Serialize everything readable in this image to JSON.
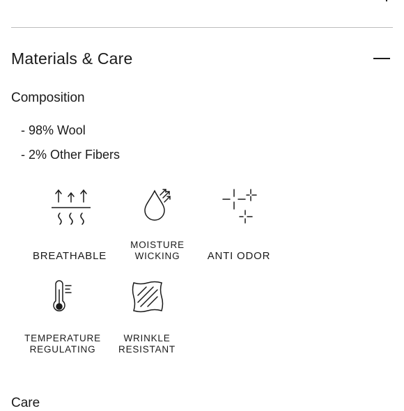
{
  "section": {
    "title": "Materials & Care"
  },
  "composition": {
    "heading": "Composition",
    "fibers": [
      "- 98% Wool",
      "- 2% Other Fibers"
    ]
  },
  "features": {
    "breathable": "BREATHABLE",
    "moisture_line1": "MOISTURE",
    "moisture_line2": "WICKING",
    "anti_odor": "ANTI ODOR",
    "temperature_line1": "TEMPERATURE",
    "temperature_line2": "REGULATING",
    "wrinkle_line1": "WRINKLE",
    "wrinkle_line2": "RESISTANT"
  },
  "care": {
    "heading": "Care"
  },
  "icons": {
    "breathable": "breathable-icon",
    "moisture": "water-drop-icon",
    "anti_odor": "sparkle-icon",
    "temperature": "thermometer-icon",
    "wrinkle": "wrinkle-fabric-icon",
    "collapse": "minus-icon"
  },
  "colors": {
    "text": "#1a1a1a",
    "divider": "#bdbdbd",
    "background": "#ffffff"
  }
}
